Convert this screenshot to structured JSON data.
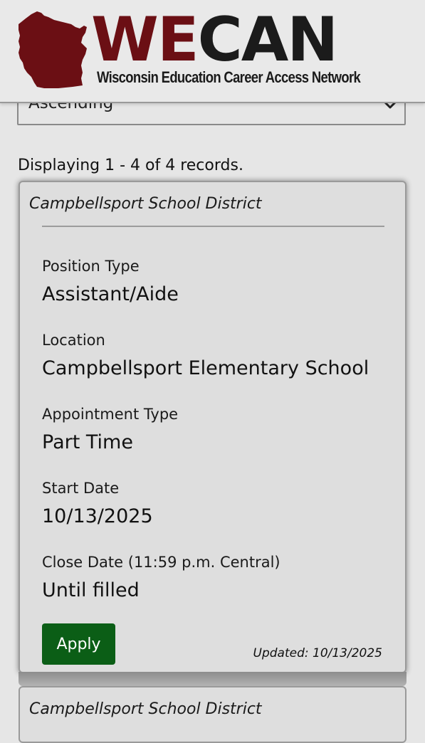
{
  "header": {
    "logo_we": "WE",
    "logo_can": "CAN",
    "logo_subtitle": "Wisconsin Education Career Access Network",
    "brand_color": "#6b0f14"
  },
  "sort": {
    "selected": "Ascending",
    "icon": "chevron-down-icon"
  },
  "records_text": "Displaying 1 - 4 of 4 records.",
  "listings": [
    {
      "district": "Campbellsport School District",
      "fields": [
        {
          "label": "Position Type",
          "value": "Assistant/Aide"
        },
        {
          "label": "Location",
          "value": "Campbellsport Elementary School"
        },
        {
          "label": "Appointment Type",
          "value": "Part Time"
        },
        {
          "label": "Start Date",
          "value": "10/13/2025"
        },
        {
          "label": "Close Date (11:59 p.m. Central)",
          "value": "Until filled"
        }
      ],
      "apply_label": "Apply",
      "apply_color": "#0b5e16",
      "updated": "Updated: 10/13/2025"
    },
    {
      "district": "Campbellsport School District"
    }
  ]
}
